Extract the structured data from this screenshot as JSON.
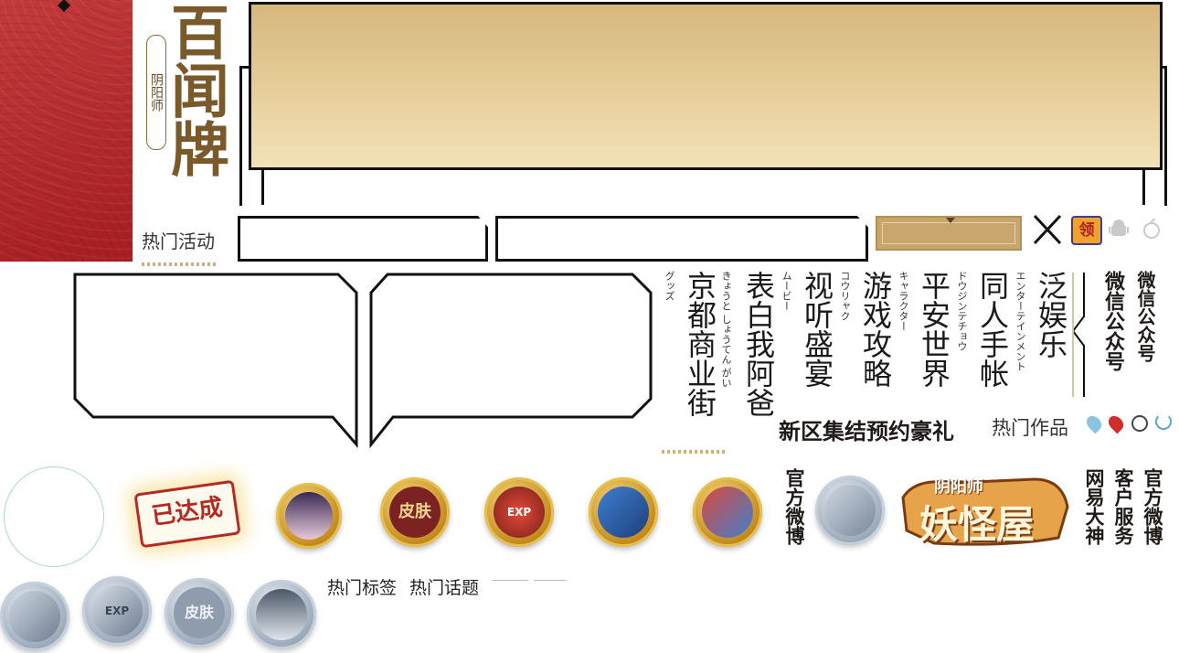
{
  "logo": {
    "title": "百闻牌",
    "seal": "阴阳师"
  },
  "nav": {
    "hot_activity": "热门活动"
  },
  "menu": {
    "columns": [
      {
        "label": "泛娱乐",
        "kana": "エンターテインメント"
      },
      {
        "label": "同人手帐",
        "kana": "ドウジンテチョウ"
      },
      {
        "label": "平安世界",
        "kana": "キャラクター"
      },
      {
        "label": "游戏攻略",
        "kana": "コウリャク"
      },
      {
        "label": "视听盛宴",
        "kana": "ムービー"
      },
      {
        "label": "表白我阿爸",
        "kana": ""
      },
      {
        "label": "京都商业街",
        "kana": "きょうと しょうてん がい"
      },
      {
        "label": "",
        "kana": "グッズ"
      }
    ],
    "wechat_big": "微信公众号",
    "wechat_small": "微信公众号"
  },
  "promo": {
    "newzone": "新区集结预约豪礼",
    "hot_works": "热门作品"
  },
  "stamp": {
    "text": "已达成"
  },
  "skin_label": "皮肤",
  "exp_label": "EXP",
  "official_weibo": "官方微博",
  "yaoguai": {
    "title_top": "阴阳师",
    "title_main": "妖怪屋"
  },
  "links": {
    "netease": "网易大神",
    "service": "客户服务",
    "weibo": "官方微博"
  },
  "tags": {
    "hot_tags": "热门标签",
    "hot_topics": "热门话题"
  },
  "colors": {
    "red": "#a61d22",
    "gold": "#d6b77e",
    "border": "#111111"
  }
}
